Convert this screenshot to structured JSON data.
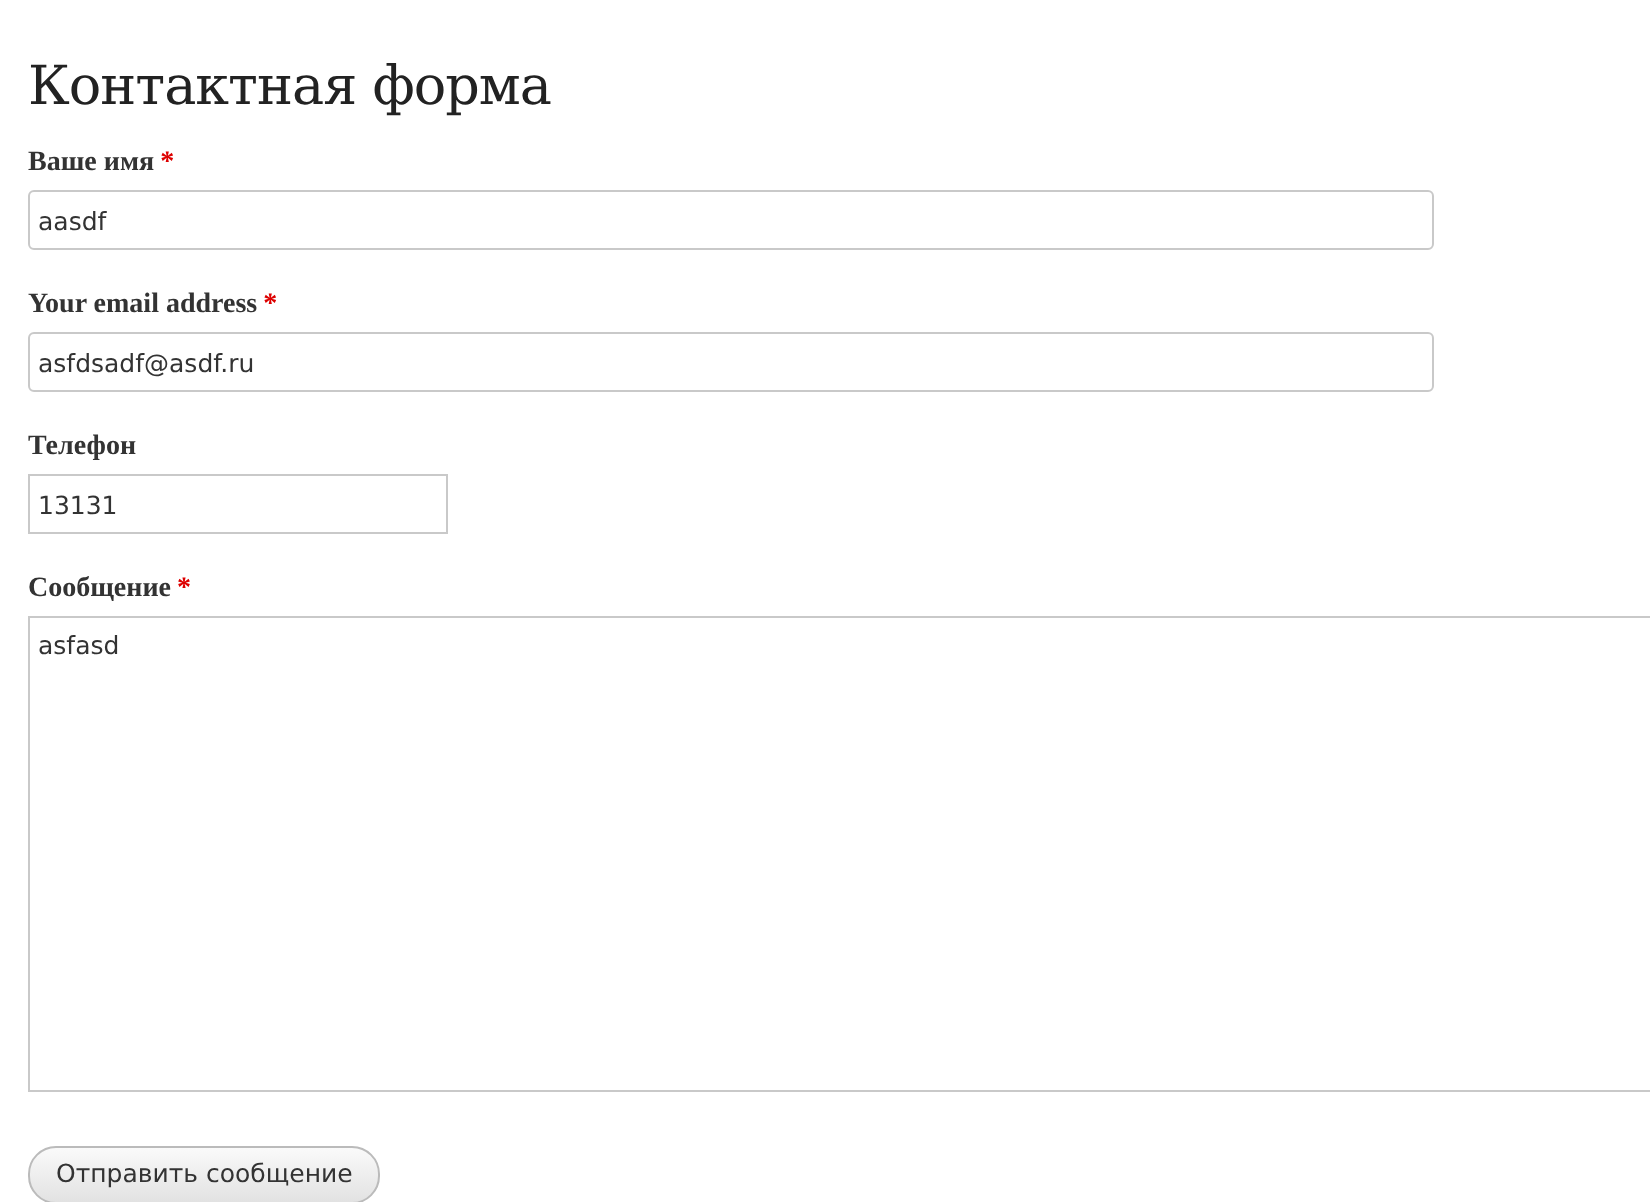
{
  "title": "Контактная форма",
  "fields": [
    {
      "kind": "wide-input",
      "label": "Ваше имя",
      "mark": "*",
      "value": "aasdf"
    },
    {
      "kind": "wide-input",
      "label": "Your email address",
      "mark": "*",
      "value": "asfdsadf@asdf.ru"
    },
    {
      "kind": "short-input",
      "label": "Телефон",
      "value": "13131"
    },
    {
      "kind": "textarea",
      "label": "Сообщение",
      "mark": "*",
      "value": "asfasd"
    }
  ],
  "submit": "Отправить сообщение"
}
